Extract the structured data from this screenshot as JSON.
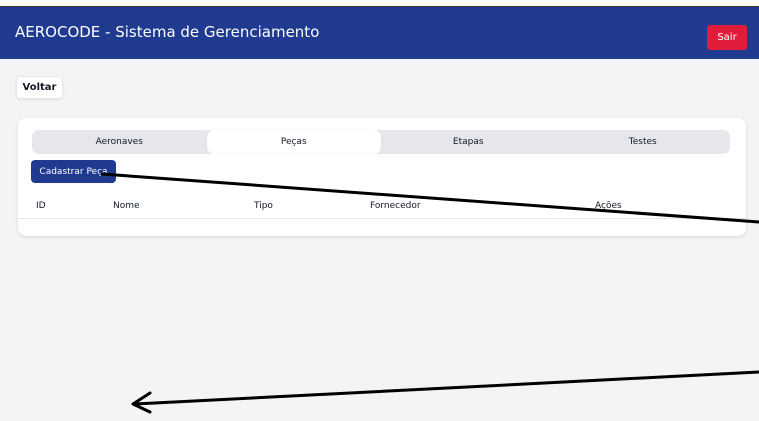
{
  "header": {
    "title": "AEROCODE - Sistema de Gerenciamento",
    "logout_label": "Sair"
  },
  "nav": {
    "back_label": "Voltar"
  },
  "tabs": [
    {
      "label": "Aeronaves",
      "active": false
    },
    {
      "label": "Peças",
      "active": true
    },
    {
      "label": "Etapas",
      "active": false
    },
    {
      "label": "Testes",
      "active": false
    }
  ],
  "actions": {
    "register_label": "Cadastrar Peça"
  },
  "table": {
    "columns": [
      "ID",
      "Nome",
      "Tipo",
      "Fornecedor",
      "Ações"
    ],
    "rows": []
  },
  "colors": {
    "brand": "#1f3a8f",
    "danger": "#e01e3c",
    "background": "#f3f4f6"
  }
}
